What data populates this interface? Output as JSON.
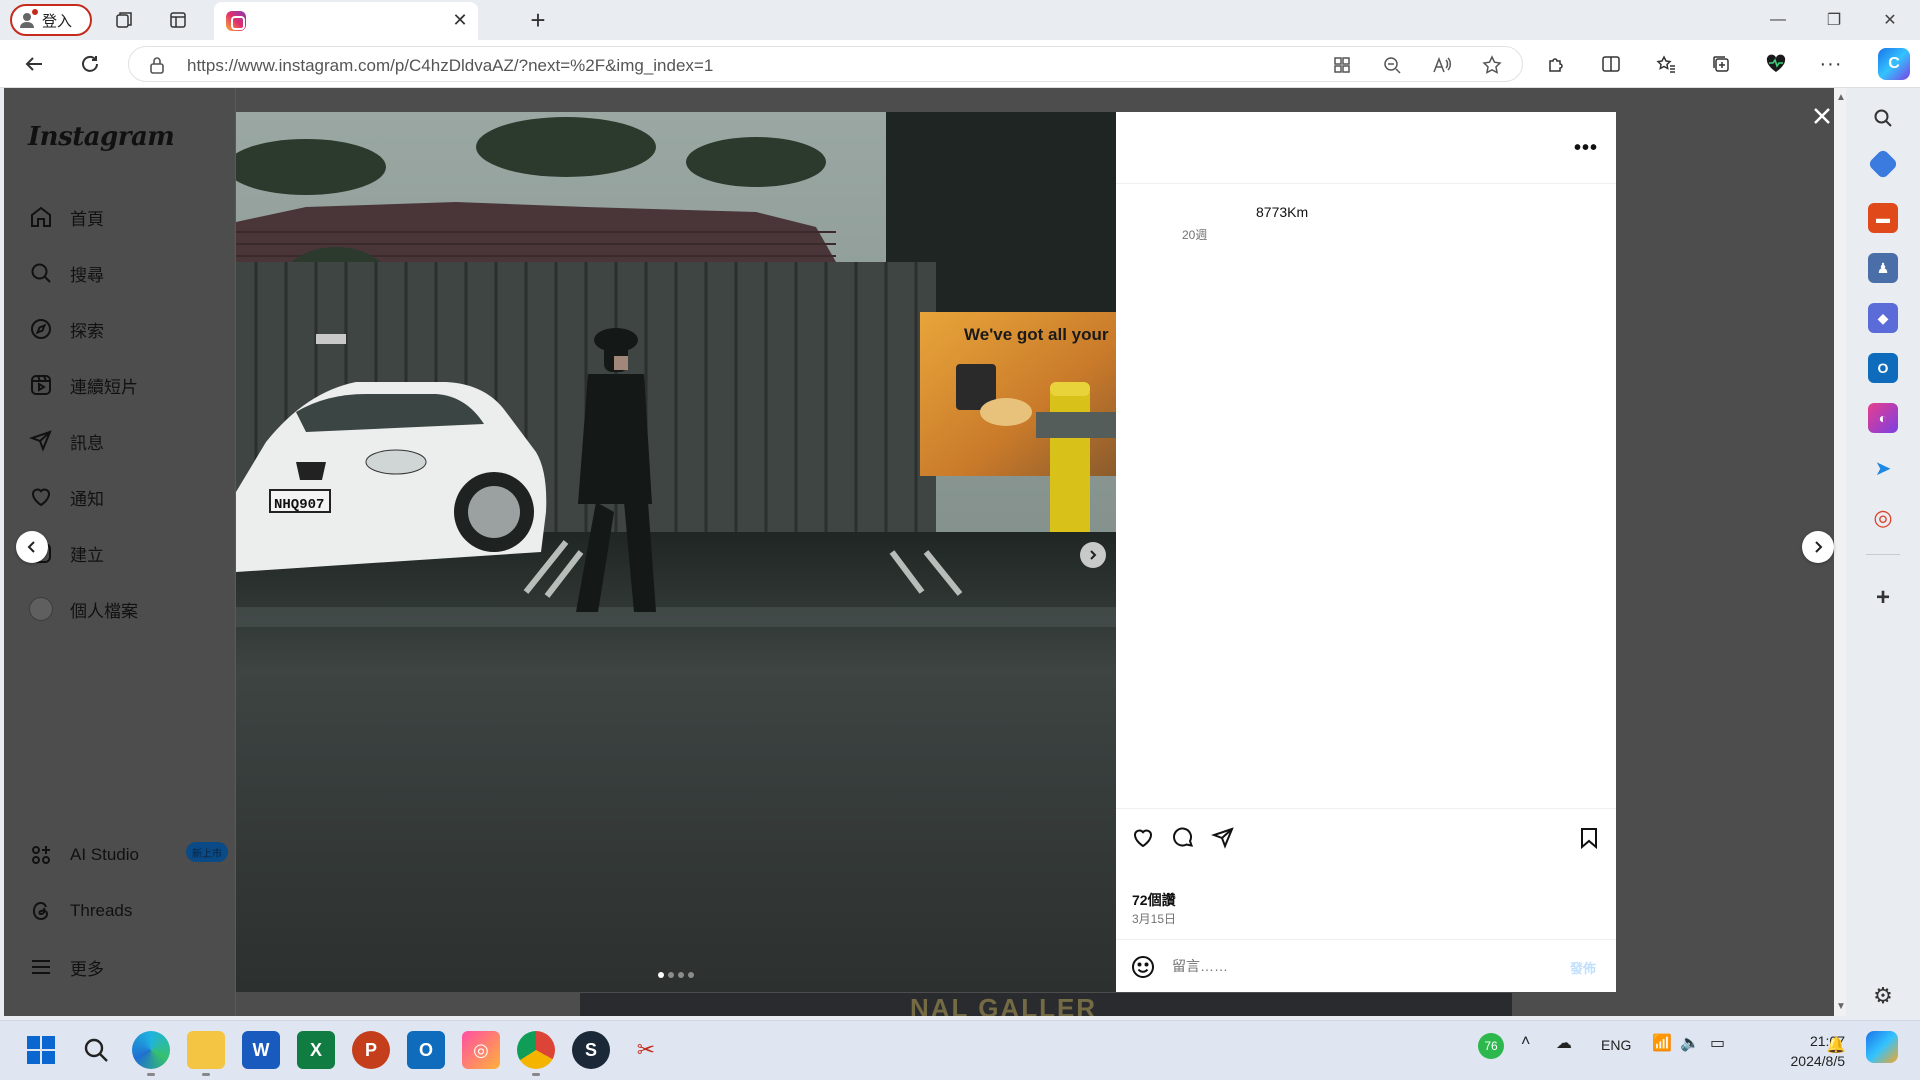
{
  "browser": {
    "profile_label": "登入",
    "url": "https://www.instagram.com/p/C4hzDldvaAZ/?next=%2F&img_index=1"
  },
  "instagram": {
    "logo": "Instagram",
    "nav": [
      {
        "label": "首頁",
        "icon": "home-icon"
      },
      {
        "label": "搜尋",
        "icon": "search-icon"
      },
      {
        "label": "探索",
        "icon": "compass-icon"
      },
      {
        "label": "連續短片",
        "icon": "reels-icon"
      },
      {
        "label": "訊息",
        "icon": "send-icon"
      },
      {
        "label": "通知",
        "icon": "heart-icon"
      },
      {
        "label": "建立",
        "icon": "plus-square-icon"
      },
      {
        "label": "個人檔案",
        "icon": "avatar"
      }
    ],
    "bottom_nav": [
      {
        "label": "AI Studio",
        "icon": "ai-studio-icon",
        "badge": "新上市"
      },
      {
        "label": "Threads",
        "icon": "threads-icon"
      },
      {
        "label": "更多",
        "icon": "menu-icon"
      }
    ]
  },
  "post": {
    "photo": {
      "sign_text": "We've got all your",
      "plate": "NHQ907",
      "carousel_total": 4,
      "carousel_active": 1
    },
    "caption_fragment": "8773Km",
    "caption_time": "20週",
    "likes": "72個讚",
    "date": "3月15日",
    "comment_placeholder": "留言……",
    "post_button": "發佈"
  },
  "taskbar": {
    "weather_badge": "76",
    "lang": "ENG",
    "time": "21:07",
    "date": "2024/8/5"
  },
  "colors": {
    "instagram_blue": "#0095f6",
    "overlay": "#4d4d4d",
    "profile_ring": "#c42b1c"
  }
}
